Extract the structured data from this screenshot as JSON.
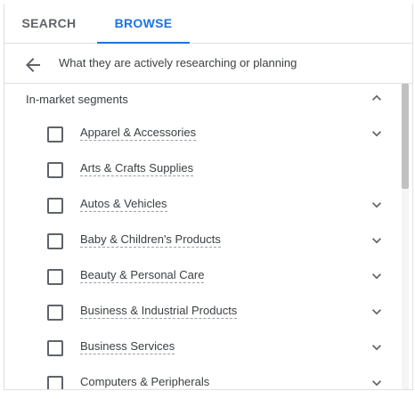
{
  "tabs": {
    "search": "SEARCH",
    "browse": "BROWSE",
    "active": "browse"
  },
  "breadcrumb": {
    "back_icon": "arrow-back-icon",
    "text": "What they are actively researching or planning"
  },
  "section": {
    "title": "In-market segments",
    "expanded": true,
    "icon": "chevron-up-icon"
  },
  "items": [
    {
      "label": "Apparel & Accessories",
      "checked": false,
      "expandable": true
    },
    {
      "label": "Arts & Crafts Supplies",
      "checked": false,
      "expandable": false
    },
    {
      "label": "Autos & Vehicles",
      "checked": false,
      "expandable": true
    },
    {
      "label": "Baby & Children's Products",
      "checked": false,
      "expandable": true
    },
    {
      "label": "Beauty & Personal Care",
      "checked": false,
      "expandable": true
    },
    {
      "label": "Business & Industrial Products",
      "checked": false,
      "expandable": true
    },
    {
      "label": "Business Services",
      "checked": false,
      "expandable": true
    },
    {
      "label": "Computers & Peripherals",
      "checked": false,
      "expandable": true
    }
  ],
  "colors": {
    "accent": "#1a73e8",
    "text": "#3c4043",
    "muted": "#5f6368",
    "divider": "#e0e0e0"
  }
}
